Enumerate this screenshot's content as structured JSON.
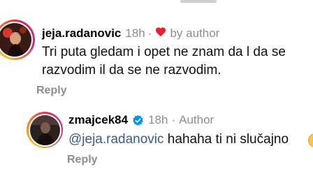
{
  "comments": [
    {
      "username": "jeja.radanovic",
      "time": "18h",
      "separator": "·",
      "liked_by": "by author",
      "icon": "heart-icon",
      "text": "Tri puta gledam i opet ne znam da l da se razvodim il da se ne razvodim.",
      "reply_label": "Reply"
    },
    {
      "username": "zmajcek84",
      "verified_icon": "verified-badge-icon",
      "time": "18h",
      "separator": "·",
      "role": "Author",
      "mention": "@jeja.radanovic",
      "text": " hahaha ti ni slučajno",
      "emoji_icon": "emoji-icon",
      "reply_label": "Reply"
    }
  ],
  "colors": {
    "heart": "#ed1c2e",
    "verified": "#0095f6",
    "mention": "#3b5a8f",
    "meta": "#8e8e8e"
  }
}
